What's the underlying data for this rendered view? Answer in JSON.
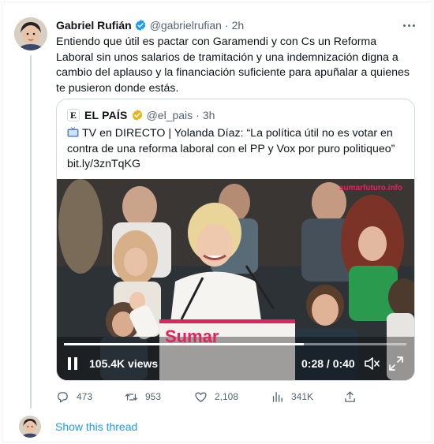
{
  "tweet": {
    "author_name": "Gabriel Rufián",
    "handle": "@gabrielrufian",
    "separator": "·",
    "time": "2h",
    "text": "Entiendo que útil es pactar con Garamendi y con Cs un Reforma Laboral sin unos salarios de tramitación y una indemnización digna a cambio del aplauso y la financiación suficiente para apuñalar a quienes te pusieron donde estás.",
    "icons": {
      "verified": "verified-badge-icon",
      "more": "more-options-icon"
    },
    "colors": {
      "verified": "#1d9bf0",
      "link": "#1d9bf0",
      "secondary_text": "#536471"
    }
  },
  "quote": {
    "logo_letter": "E",
    "author_name": "EL PAÍS",
    "handle": "@el_pais",
    "separator": "·",
    "time": "3h",
    "text": "TV en DIRECTO | Yolanda Díaz: “La política útil no es votar en contra de una reforma laboral con el PP y Vox por puro politiqueo”",
    "link": "bit.ly/3znTqKG",
    "icons": {
      "tv": "tv-icon",
      "verified": "gold-verified-badge-icon"
    },
    "colors": {
      "verified": "#e2b719"
    }
  },
  "video": {
    "watermark": "sumarfuturo.info",
    "podium_text": "Sumar",
    "views": "105.4K views",
    "time_display": "0:28 / 0:40",
    "progress": 0.7,
    "icons": {
      "pause": "pause-icon",
      "mute": "mute-icon",
      "fullscreen": "fullscreen-icon"
    },
    "colors": {
      "brand": "#e0245e"
    }
  },
  "actions": {
    "reply_count": "473",
    "retweet_count": "953",
    "like_count": "2,108",
    "views_count": "341K",
    "icons": [
      "reply-icon",
      "retweet-icon",
      "like-icon",
      "views-icon",
      "share-icon"
    ]
  },
  "footer": {
    "show_thread": "Show this thread"
  }
}
